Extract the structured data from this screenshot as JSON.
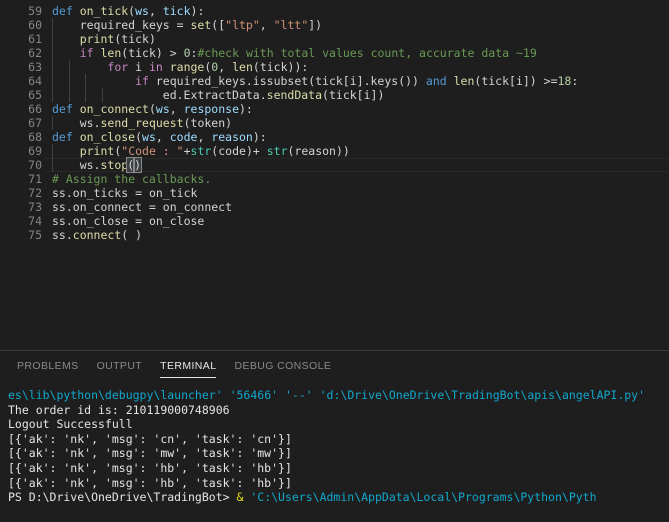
{
  "editor": {
    "first_line_number": 59,
    "cursor_line": 70,
    "lines": [
      {
        "n": 59,
        "indent": 0,
        "tokens": [
          {
            "t": "def ",
            "c": "k"
          },
          {
            "t": "on_tick",
            "c": "fn"
          },
          {
            "t": "(",
            "c": "pl"
          },
          {
            "t": "ws",
            "c": "var"
          },
          {
            "t": ", ",
            "c": "pl"
          },
          {
            "t": "tick",
            "c": "var"
          },
          {
            "t": "):",
            "c": "pl"
          }
        ]
      },
      {
        "n": 60,
        "indent": 1,
        "tokens": [
          {
            "t": "    ",
            "c": "pl"
          },
          {
            "t": "required_keys",
            "c": "pl"
          },
          {
            "t": " = ",
            "c": "pl"
          },
          {
            "t": "set",
            "c": "fn"
          },
          {
            "t": "([",
            "c": "pl"
          },
          {
            "t": "\"ltp\"",
            "c": "str"
          },
          {
            "t": ", ",
            "c": "pl"
          },
          {
            "t": "\"ltt\"",
            "c": "str"
          },
          {
            "t": "])",
            "c": "pl"
          }
        ]
      },
      {
        "n": 61,
        "indent": 1,
        "tokens": [
          {
            "t": "    ",
            "c": "pl"
          },
          {
            "t": "print",
            "c": "fn"
          },
          {
            "t": "(",
            "c": "pl"
          },
          {
            "t": "tick",
            "c": "pl"
          },
          {
            "t": ")",
            "c": "pl"
          }
        ]
      },
      {
        "n": 62,
        "indent": 1,
        "tokens": [
          {
            "t": "    ",
            "c": "pl"
          },
          {
            "t": "if ",
            "c": "kc"
          },
          {
            "t": "len",
            "c": "fn"
          },
          {
            "t": "(",
            "c": "pl"
          },
          {
            "t": "tick",
            "c": "pl"
          },
          {
            "t": ") > ",
            "c": "pl"
          },
          {
            "t": "0",
            "c": "num"
          },
          {
            "t": ":",
            "c": "pl"
          },
          {
            "t": "#check with total values count, accurate data ~19",
            "c": "cmt"
          }
        ]
      },
      {
        "n": 63,
        "indent": 2,
        "tokens": [
          {
            "t": "        ",
            "c": "pl"
          },
          {
            "t": "for ",
            "c": "kc"
          },
          {
            "t": "i ",
            "c": "pl"
          },
          {
            "t": "in ",
            "c": "kc"
          },
          {
            "t": "range",
            "c": "fn"
          },
          {
            "t": "(",
            "c": "pl"
          },
          {
            "t": "0",
            "c": "num"
          },
          {
            "t": ", ",
            "c": "pl"
          },
          {
            "t": "len",
            "c": "fn"
          },
          {
            "t": "(",
            "c": "pl"
          },
          {
            "t": "tick",
            "c": "pl"
          },
          {
            "t": ")):",
            "c": "pl"
          }
        ]
      },
      {
        "n": 64,
        "indent": 3,
        "tokens": [
          {
            "t": "            ",
            "c": "pl"
          },
          {
            "t": "if ",
            "c": "kc"
          },
          {
            "t": "required_keys.issubset(tick[i].keys())",
            "c": "pl"
          },
          {
            "t": " and ",
            "c": "k"
          },
          {
            "t": "len",
            "c": "fn"
          },
          {
            "t": "(",
            "c": "pl"
          },
          {
            "t": "tick[i]",
            "c": "pl"
          },
          {
            "t": ") >=",
            "c": "pl"
          },
          {
            "t": "18",
            "c": "num"
          },
          {
            "t": ":",
            "c": "pl"
          }
        ]
      },
      {
        "n": 65,
        "indent": 4,
        "tokens": [
          {
            "t": "                ",
            "c": "pl"
          },
          {
            "t": "ed.ExtractData.",
            "c": "pl"
          },
          {
            "t": "sendData",
            "c": "fn"
          },
          {
            "t": "(",
            "c": "pl"
          },
          {
            "t": "tick[i]",
            "c": "pl"
          },
          {
            "t": ")",
            "c": "pl"
          }
        ]
      },
      {
        "n": 66,
        "indent": 0,
        "tokens": [
          {
            "t": "def ",
            "c": "k"
          },
          {
            "t": "on_connect",
            "c": "fn"
          },
          {
            "t": "(",
            "c": "pl"
          },
          {
            "t": "ws",
            "c": "var"
          },
          {
            "t": ", ",
            "c": "pl"
          },
          {
            "t": "response",
            "c": "var"
          },
          {
            "t": "):",
            "c": "pl"
          }
        ]
      },
      {
        "n": 67,
        "indent": 1,
        "tokens": [
          {
            "t": "    ",
            "c": "pl"
          },
          {
            "t": "ws.",
            "c": "pl"
          },
          {
            "t": "send_request",
            "c": "fn"
          },
          {
            "t": "(",
            "c": "pl"
          },
          {
            "t": "token",
            "c": "pl"
          },
          {
            "t": ")",
            "c": "pl"
          }
        ]
      },
      {
        "n": 68,
        "indent": 0,
        "tokens": [
          {
            "t": "def ",
            "c": "k"
          },
          {
            "t": "on_close",
            "c": "fn"
          },
          {
            "t": "(",
            "c": "pl"
          },
          {
            "t": "ws",
            "c": "var"
          },
          {
            "t": ", ",
            "c": "pl"
          },
          {
            "t": "code",
            "c": "var"
          },
          {
            "t": ", ",
            "c": "pl"
          },
          {
            "t": "reason",
            "c": "var"
          },
          {
            "t": "):",
            "c": "pl"
          }
        ]
      },
      {
        "n": 69,
        "indent": 1,
        "tokens": [
          {
            "t": "    ",
            "c": "pl"
          },
          {
            "t": "print",
            "c": "fn"
          },
          {
            "t": "(",
            "c": "pl"
          },
          {
            "t": "\"Code : \"",
            "c": "str"
          },
          {
            "t": "+",
            "c": "pl"
          },
          {
            "t": "str",
            "c": "cls"
          },
          {
            "t": "(",
            "c": "pl"
          },
          {
            "t": "code",
            "c": "pl"
          },
          {
            "t": ")+ ",
            "c": "pl"
          },
          {
            "t": "str",
            "c": "cls"
          },
          {
            "t": "(",
            "c": "pl"
          },
          {
            "t": "reason",
            "c": "pl"
          },
          {
            "t": "))",
            "c": "pl"
          }
        ]
      },
      {
        "n": 70,
        "indent": 1,
        "cursor": true,
        "tokens": [
          {
            "t": "    ",
            "c": "pl"
          },
          {
            "t": "ws.",
            "c": "pl"
          },
          {
            "t": "stop",
            "c": "fn"
          },
          {
            "t": "CARET",
            "c": "caret"
          },
          {
            "t": "(",
            "c": "brk"
          },
          {
            "t": ")",
            "c": "brk"
          }
        ]
      },
      {
        "n": 71,
        "indent": 0,
        "tokens": [
          {
            "t": "# Assign the callbacks.",
            "c": "cmt"
          }
        ]
      },
      {
        "n": 72,
        "indent": 0,
        "tokens": [
          {
            "t": "ss.on_ticks",
            "c": "pl"
          },
          {
            "t": " = ",
            "c": "pl"
          },
          {
            "t": "on_tick",
            "c": "pl"
          }
        ]
      },
      {
        "n": 73,
        "indent": 0,
        "tokens": [
          {
            "t": "ss.on_connect",
            "c": "pl"
          },
          {
            "t": " = ",
            "c": "pl"
          },
          {
            "t": "on_connect",
            "c": "pl"
          }
        ]
      },
      {
        "n": 74,
        "indent": 0,
        "tokens": [
          {
            "t": "ss.on_close",
            "c": "pl"
          },
          {
            "t": " = ",
            "c": "pl"
          },
          {
            "t": "on_close",
            "c": "pl"
          }
        ]
      },
      {
        "n": 75,
        "indent": 0,
        "tokens": [
          {
            "t": "ss.",
            "c": "pl"
          },
          {
            "t": "connect",
            "c": "fn"
          },
          {
            "t": "( )",
            "c": "pl"
          }
        ]
      }
    ]
  },
  "panel": {
    "tabs": [
      {
        "label": "PROBLEMS",
        "selected": false
      },
      {
        "label": "OUTPUT",
        "selected": false
      },
      {
        "label": "TERMINAL",
        "selected": true
      },
      {
        "label": "DEBUG CONSOLE",
        "selected": false
      }
    ],
    "terminal": {
      "lines": [
        {
          "segments": [
            {
              "t": "es\\lib\\python\\debugpy\\launcher'",
              "c": "c-cyan"
            },
            {
              "t": " ",
              "c": "c-white"
            },
            {
              "t": "'56466'",
              "c": "c-cyan"
            },
            {
              "t": " ",
              "c": "c-white"
            },
            {
              "t": "'--'",
              "c": "c-cyan"
            },
            {
              "t": " ",
              "c": "c-white"
            },
            {
              "t": "'d:\\Drive\\OneDrive\\TradingBot\\apis\\angelAPI.py'",
              "c": "c-cyan"
            }
          ]
        },
        {
          "segments": [
            {
              "t": "The order id is: 210119000748906",
              "c": "c-white"
            }
          ]
        },
        {
          "segments": [
            {
              "t": "Logout Successfull",
              "c": "c-white"
            }
          ]
        },
        {
          "segments": [
            {
              "t": "[{'ak': 'nk', 'msg': 'cn', 'task': 'cn'}]",
              "c": "c-white"
            }
          ]
        },
        {
          "segments": [
            {
              "t": "[{'ak': 'nk', 'msg': 'mw', 'task': 'mw'}]",
              "c": "c-white"
            }
          ]
        },
        {
          "segments": [
            {
              "t": "[{'ak': 'nk', 'msg': 'hb', 'task': 'hb'}]",
              "c": "c-white"
            }
          ]
        },
        {
          "segments": [
            {
              "t": "[{'ak': 'nk', 'msg': 'hb', 'task': 'hb'}]",
              "c": "c-white"
            }
          ]
        },
        {
          "segments": [
            {
              "t": "PS D:\\Drive\\OneDrive\\TradingBot> ",
              "c": "c-white"
            },
            {
              "t": "& ",
              "c": "c-yellow"
            },
            {
              "t": "'C:\\Users\\Admin\\AppData\\Local\\Programs\\Python\\Pyth",
              "c": "c-cyan"
            }
          ]
        }
      ]
    }
  },
  "colors": {
    "editor_bg": "#1e1e1e",
    "panel_bg": "#1e1e1e",
    "line_number": "#858585",
    "keyword": "#569cd6",
    "control_keyword": "#c586c0",
    "function": "#dcdcaa",
    "class": "#4ec9b0",
    "string": "#ce9178",
    "number": "#b5cea8",
    "comment": "#6a9955",
    "parameter": "#9cdcfe",
    "terminal_cyan": "#11a8cd",
    "terminal_text": "#cccccc",
    "tab_active": "#e7e7e7",
    "tab_inactive": "#8a8a8a"
  }
}
